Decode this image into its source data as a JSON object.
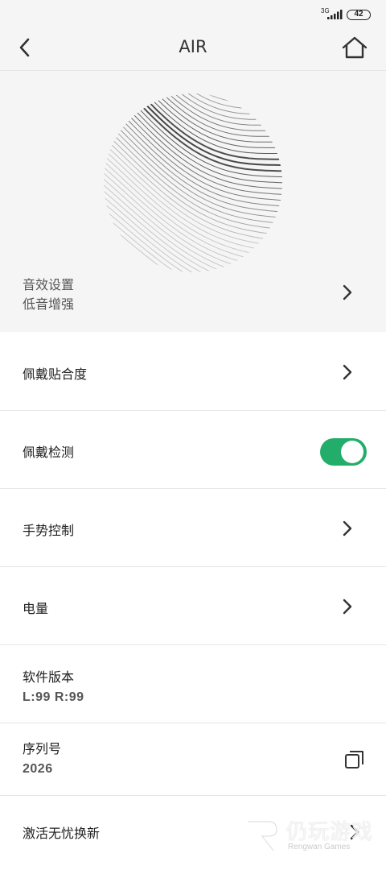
{
  "status_bar": {
    "network": "3G",
    "battery": "42"
  },
  "header": {
    "title": "AIR"
  },
  "sound": {
    "title": "音效设置",
    "subtitle": "低音增强"
  },
  "rows": {
    "fit": {
      "label": "佩戴贴合度"
    },
    "wear_detection": {
      "label": "佩戴检测",
      "enabled": true
    },
    "gesture": {
      "label": "手势控制"
    },
    "battery": {
      "label": "电量"
    },
    "firmware": {
      "label": "软件版本",
      "value": "L:99   R:99"
    },
    "serial": {
      "label": "序列号",
      "value": "2026"
    },
    "activate": {
      "label": "激活无忧换新"
    }
  },
  "watermark": {
    "main": "仍玩游戏",
    "sub": "Rengwan Games"
  },
  "colors": {
    "toggle_on": "#22ae6a",
    "background_gray": "#f5f5f5"
  },
  "icons": {
    "back": "chevron-left-icon",
    "home": "home-icon",
    "chevron": "chevron-right-icon",
    "copy": "copy-icon"
  }
}
